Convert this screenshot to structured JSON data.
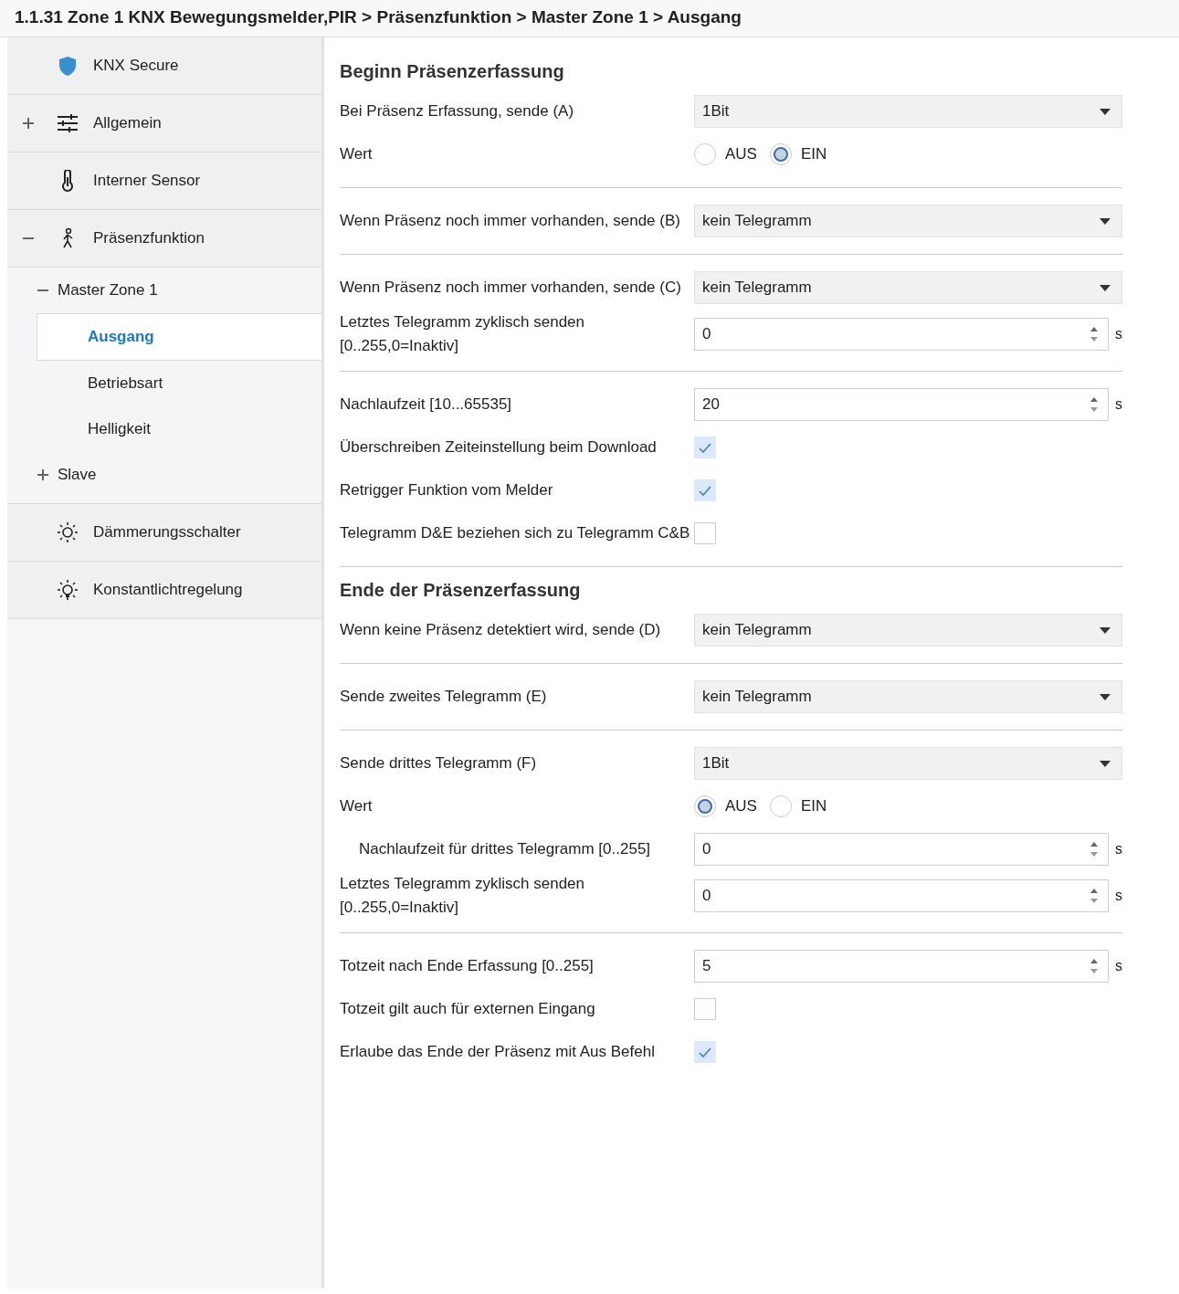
{
  "title": "1.1.31 Zone 1 KNX Bewegungsmelder,PIR > Präsenzfunktion > Master Zone 1 > Ausgang",
  "sidebar": {
    "items": [
      {
        "label": "KNX Secure",
        "selected": false
      },
      {
        "label": "Allgemein",
        "selected": false,
        "expanded": false
      },
      {
        "label": "Interner Sensor",
        "selected": false
      },
      {
        "label": "Präsenzfunktion",
        "selected": false,
        "expanded": true,
        "children": [
          {
            "label": "Master Zone 1",
            "selected": false,
            "expanded": true,
            "children": [
              {
                "label": "Ausgang",
                "selected": true
              },
              {
                "label": "Betriebsart",
                "selected": false
              },
              {
                "label": "Helligkeit",
                "selected": false
              }
            ]
          },
          {
            "label": "Slave",
            "selected": false,
            "expanded": false
          }
        ]
      },
      {
        "label": "Dämmerungsschalter",
        "selected": false
      },
      {
        "label": "Konstantlichtregelung",
        "selected": false
      }
    ]
  },
  "sections": [
    {
      "title": "Beginn Präsenzerfassung",
      "rows": [
        {
          "kind": "select",
          "label": "Bei Präsenz Erfassung, sende (A)",
          "value": "1Bit"
        },
        {
          "kind": "radio",
          "label": "Wert",
          "options": [
            {
              "label": "AUS",
              "selected": false
            },
            {
              "label": "EIN",
              "selected": true
            }
          ]
        },
        {
          "kind": "divider"
        },
        {
          "kind": "select",
          "label": "Wenn Präsenz noch immer vorhanden, sende (B)",
          "value": "kein Telegramm"
        },
        {
          "kind": "divider"
        },
        {
          "kind": "select",
          "label": "Wenn Präsenz noch immer vorhanden, sende (C)",
          "value": "kein Telegramm"
        },
        {
          "kind": "spin",
          "label": "Letztes Telegramm zyklisch senden [0..255,0=Inaktiv]",
          "value": "0",
          "unit": "s"
        },
        {
          "kind": "divider"
        },
        {
          "kind": "spin",
          "label": "Nachlaufzeit [10...65535]",
          "value": "20",
          "unit": "s"
        },
        {
          "kind": "check",
          "label": "Überschreiben Zeiteinstellung beim Download",
          "checked": true
        },
        {
          "kind": "check",
          "label": "Retrigger Funktion vom Melder",
          "checked": true
        },
        {
          "kind": "check",
          "label": "Telegramm D&E beziehen sich zu Telegramm C&B",
          "checked": false
        },
        {
          "kind": "divider"
        }
      ]
    },
    {
      "title": "Ende der Präsenzerfassung",
      "rows": [
        {
          "kind": "select",
          "label": "Wenn keine Präsenz detektiert wird, sende (D)",
          "value": "kein Telegramm"
        },
        {
          "kind": "divider"
        },
        {
          "kind": "select",
          "label": "Sende zweites Telegramm (E)",
          "value": "kein Telegramm"
        },
        {
          "kind": "divider"
        },
        {
          "kind": "select",
          "label": "Sende drittes Telegramm (F)",
          "value": "1Bit"
        },
        {
          "kind": "radio",
          "label": "Wert",
          "options": [
            {
              "label": "AUS",
              "selected": true
            },
            {
              "label": "EIN",
              "selected": false
            }
          ],
          "children": [
            {
              "kind": "spin",
              "label": "Nachlaufzeit für drittes Telegramm [0..255]",
              "value": "0",
              "unit": "s"
            }
          ]
        },
        {
          "kind": "spin",
          "label": "Letztes Telegramm zyklisch senden [0..255,0=Inaktiv]",
          "value": "0",
          "unit": "s"
        },
        {
          "kind": "divider"
        },
        {
          "kind": "spin",
          "label": "Totzeit nach Ende Erfassung [0..255]",
          "value": "5",
          "unit": "s"
        },
        {
          "kind": "check",
          "label": "Totzeit gilt auch für externen Eingang",
          "checked": false
        },
        {
          "kind": "check",
          "label": "Erlaube das Ende der Präsenz mit Aus Befehl",
          "checked": true
        }
      ]
    }
  ]
}
